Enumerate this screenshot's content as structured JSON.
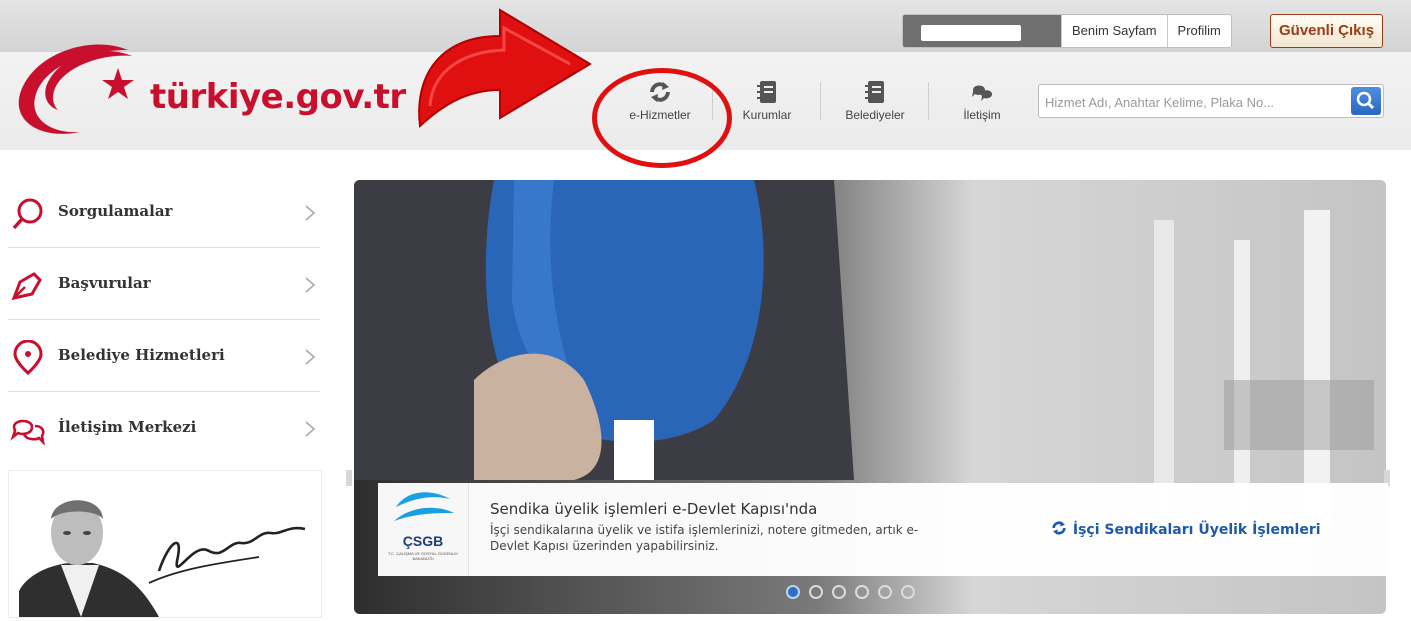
{
  "header": {
    "logo_text": "türkiye.gov.tr",
    "user_links": [
      "Benim Sayfam",
      "Profilim"
    ],
    "logout_label": "Güvenli Çıkış",
    "search_placeholder": "Hizmet Adı, Anahtar Kelime, Plaka No...",
    "nav": [
      {
        "label": "e-Hizmetler",
        "icon": "refresh-icon"
      },
      {
        "label": "Kurumlar",
        "icon": "book-icon"
      },
      {
        "label": "Belediyeler",
        "icon": "book-icon"
      },
      {
        "label": "İletişim",
        "icon": "chat-icon"
      }
    ],
    "annotation_color": "#e01010"
  },
  "sidebar": {
    "items": [
      {
        "label": "Sorgulamalar",
        "icon": "search-icon"
      },
      {
        "label": "Başvurular",
        "icon": "pen-icon"
      },
      {
        "label": "Belediye Hizmetleri",
        "icon": "location-pin-icon"
      },
      {
        "label": "İletişim Merkezi",
        "icon": "chat-icon"
      }
    ]
  },
  "slider": {
    "logo_text": "ÇSGB",
    "logo_subtext": "T.C. ÇALIŞMA VE SOSYAL GÜVENLİK BAKANLIĞI",
    "title": "Sendika üyelik işlemleri e-Devlet Kapısı'nda",
    "description": "İşçi sendikalarına üyelik ve istifa işlemlerinizi, notere gitmeden, artık e-Devlet Kapısı üzerinden yapabilirsiniz.",
    "link_label": "İşçi Sendikaları Üyelik İşlemleri",
    "slide_count": 6,
    "active_slide": 1
  },
  "colors": {
    "brand_red": "#c8102e",
    "link_blue": "#1f5aa8",
    "logout_brown": "#9e3a16"
  }
}
